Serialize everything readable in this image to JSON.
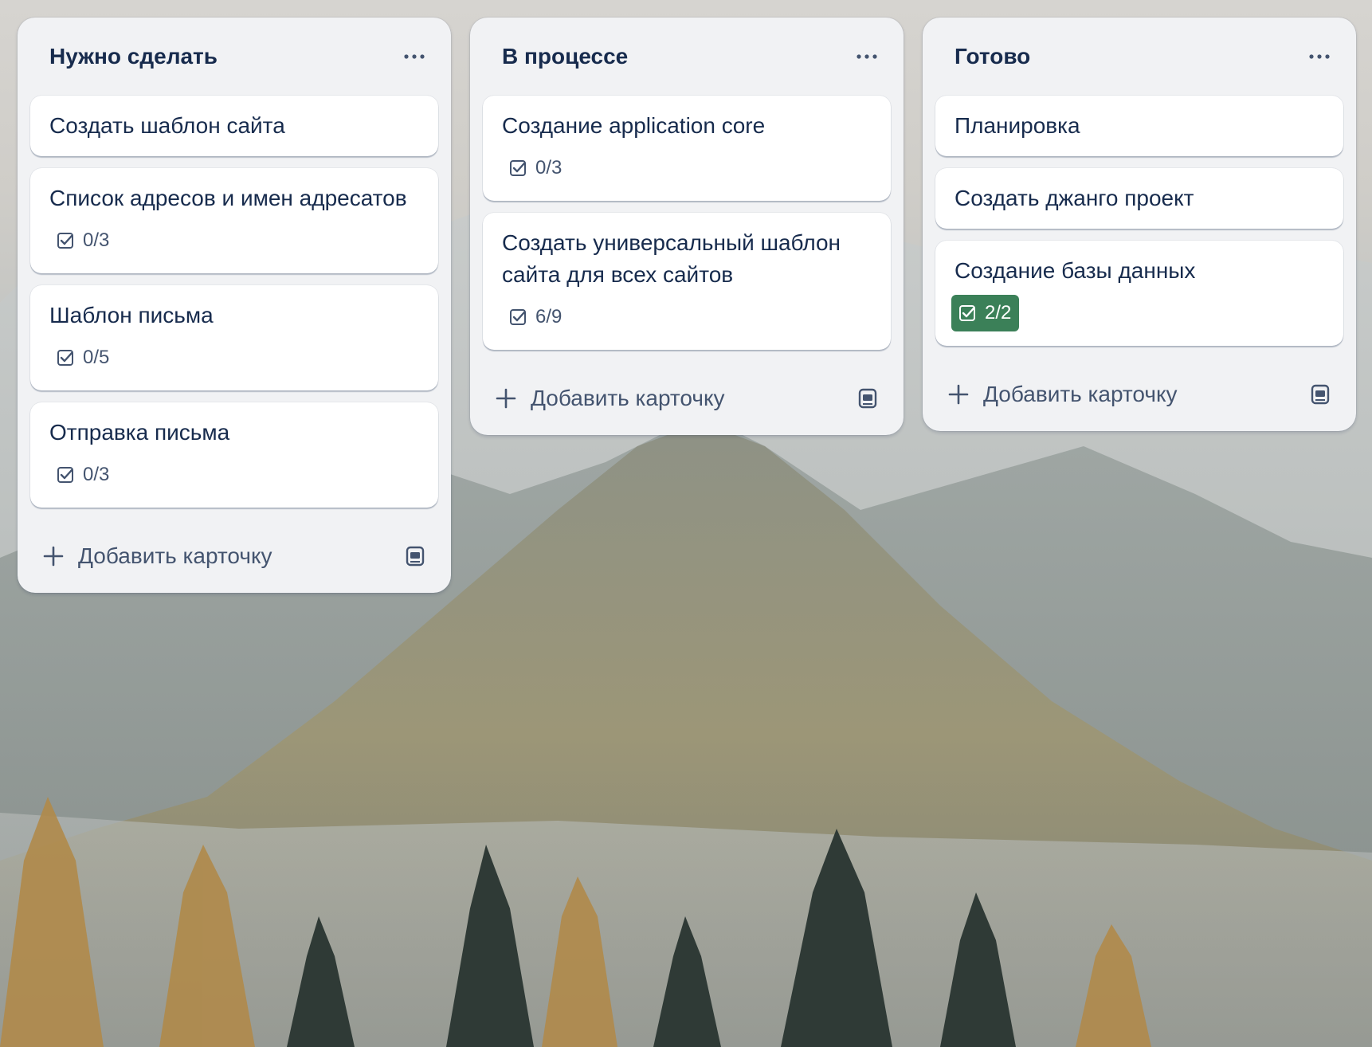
{
  "board": {
    "lists": [
      {
        "title": "Нужно сделать",
        "cards": [
          {
            "title": "Создать шаблон сайта"
          },
          {
            "title": "Список адресов и имен адресатов",
            "checklist": "0/3"
          },
          {
            "title": "Шаблон письма",
            "checklist": "0/5"
          },
          {
            "title": "Отправка письма",
            "checklist": "0/3"
          }
        ],
        "add_label": "Добавить карточку"
      },
      {
        "title": "В процессе",
        "cards": [
          {
            "title": "Создание application core",
            "checklist": "0/3"
          },
          {
            "title": "Создать универсальный шаблон сайта для всех сайтов",
            "checklist": "6/9"
          }
        ],
        "add_label": "Добавить карточку"
      },
      {
        "title": "Готово",
        "cards": [
          {
            "title": "Планировка"
          },
          {
            "title": "Создать джанго проект"
          },
          {
            "title": "Создание базы данных",
            "checklist": "2/2"
          }
        ],
        "add_label": "Добавить карточку"
      }
    ]
  },
  "icons": {
    "list_menu": "more-horizontal-icon",
    "checklist": "checkbox-checked-icon",
    "add": "plus-icon",
    "template": "card-template-icon"
  },
  "colors": {
    "list_bg": "#f1f2f4",
    "card_bg": "#ffffff",
    "text": "#172b4d",
    "subtle_text": "#44546f",
    "checklist_complete": "#3b8058"
  }
}
